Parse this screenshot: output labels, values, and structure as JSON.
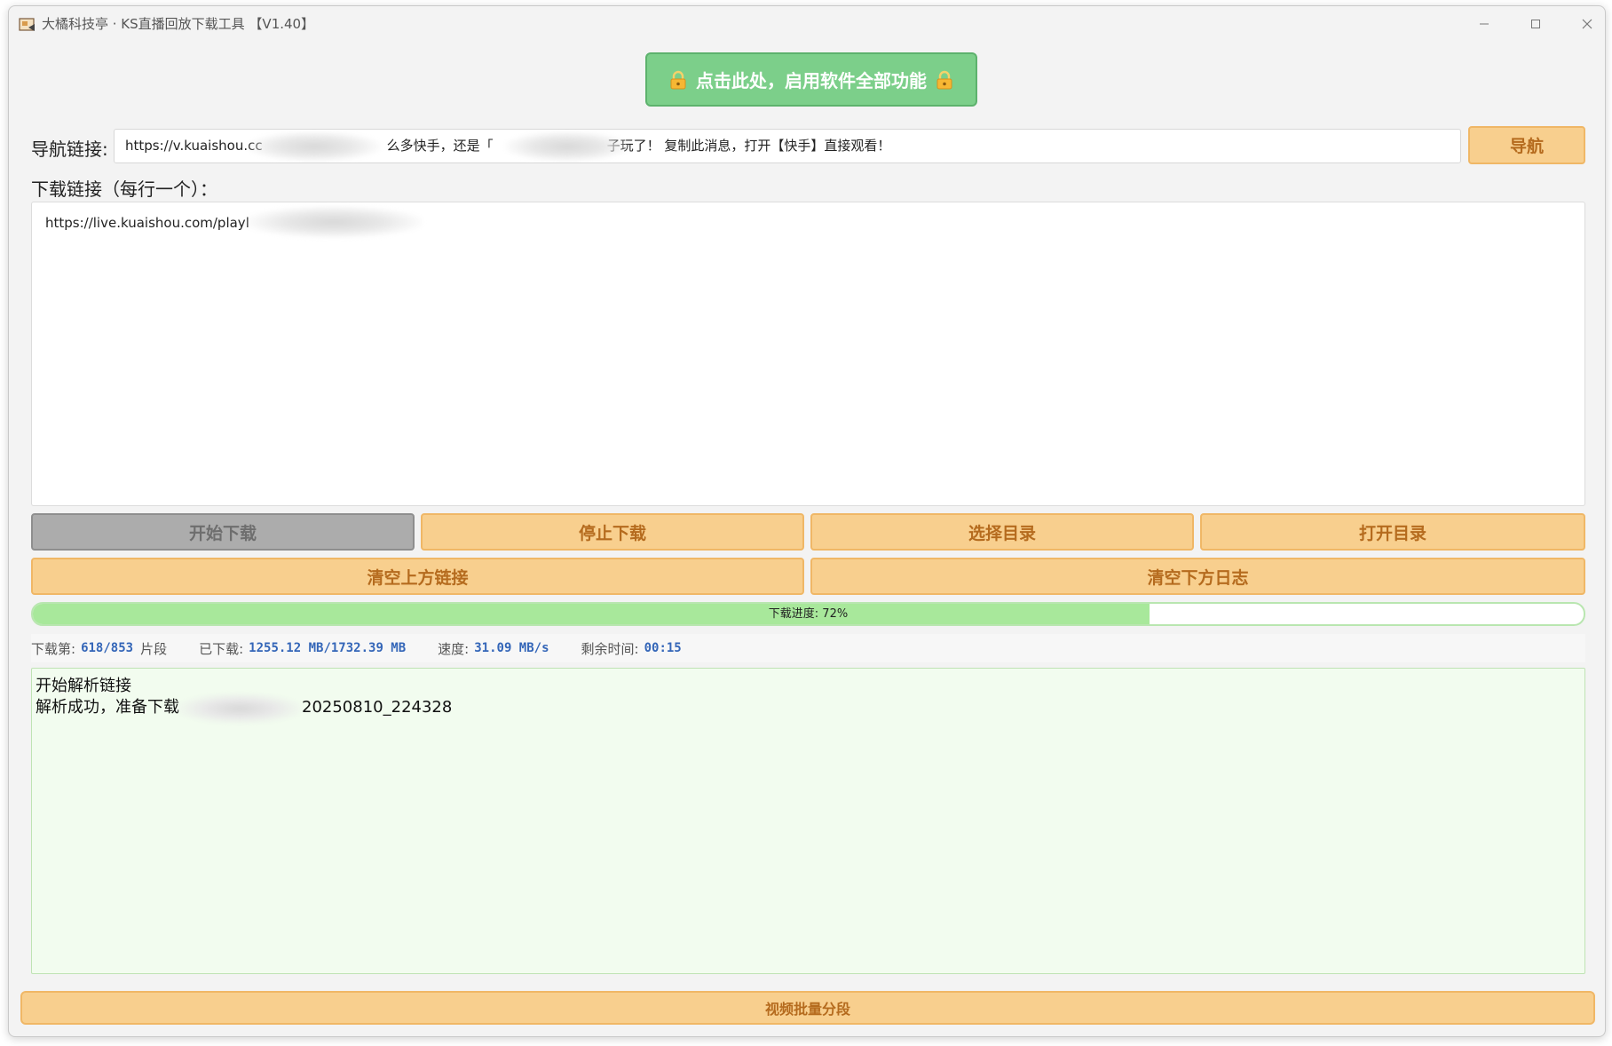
{
  "window": {
    "title": "大橘科技亭 · KS直播回放下载工具 【V1.40】",
    "minimize": "—",
    "maximize": "☐",
    "close": "✕"
  },
  "unlock": {
    "label": "点击此处，启用软件全部功能",
    "icon": "lock-icon",
    "color": "#7ccf8a"
  },
  "nav": {
    "label": "导航链接:",
    "value_start": "https://v.kuaishou.cc",
    "value_mid": "么多快手，还是「",
    "value_end": "子玩了！ 复制此消息，打开【快手】直接观看！",
    "button": "导航"
  },
  "download": {
    "label": "下载链接（每行一个）：",
    "value": "https://live.kuaishou.com/playl"
  },
  "buttons": {
    "start": "开始下载",
    "stop": "停止下载",
    "choose_dir": "选择目录",
    "open_dir": "打开目录",
    "clear_links": "清空上方链接",
    "clear_log": "清空下方日志",
    "batch_segment": "视频批量分段"
  },
  "progress": {
    "label": "下载进度: 72%",
    "percent": 72,
    "color": "#a8e89b"
  },
  "stats": {
    "segment_label": "下载第:",
    "segment_value": "618/853",
    "segment_unit": "片段",
    "downloaded_label": "已下载:",
    "downloaded_value": "1255.12 MB/1732.39 MB",
    "speed_label": "速度:",
    "speed_value": "31.09 MB/s",
    "remaining_label": "剩余时间:",
    "remaining_value": "00:15"
  },
  "log": {
    "line1": "开始解析链接",
    "line2_prefix": "解析成功，准备下载",
    "line2_suffix": "20250810_224328"
  },
  "colors": {
    "button_bg": "#f8cf8e",
    "button_text": "#b56b1e",
    "disabled_bg": "#acacac",
    "log_bg": "#f2fcef",
    "stat_value": "#3466b8"
  }
}
